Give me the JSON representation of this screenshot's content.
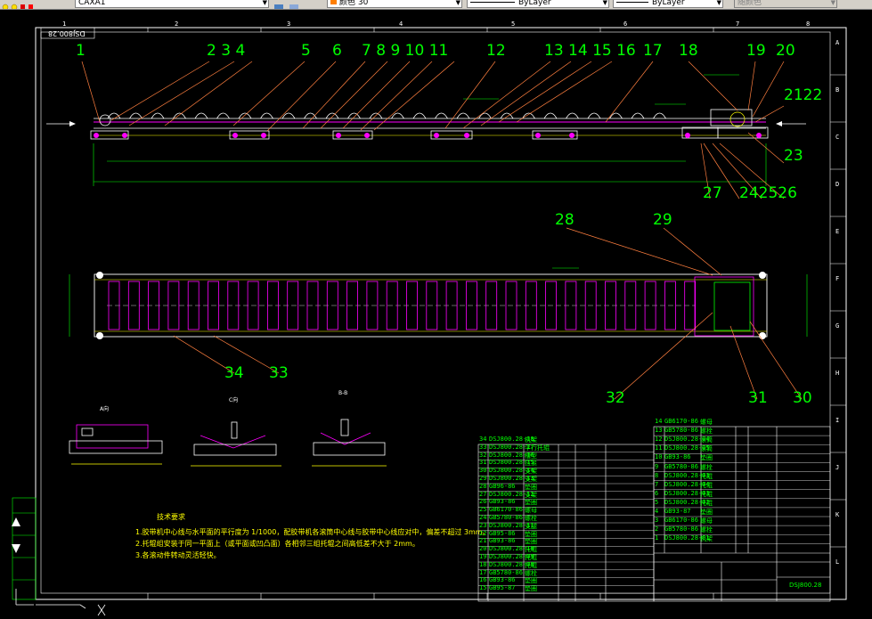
{
  "toolbar": {
    "layer_value": "CAXA1",
    "color_label": "颜色 30",
    "linetype_value": "ByLayer",
    "lineweight_value": "ByLayer",
    "plot_style": "随颜色"
  },
  "drawing": {
    "drawing_number_top": "DSJ800.28",
    "drawing_number_bottom": "DSJ800.28",
    "columns": [
      "1",
      "2",
      "3",
      "4",
      "5",
      "6",
      "7",
      "8"
    ],
    "rows": [
      "A",
      "B",
      "C",
      "D",
      "E",
      "F",
      "G",
      "H",
      "I",
      "J",
      "K",
      "L"
    ],
    "section_labels": [
      "A向",
      "C向",
      "B-B"
    ],
    "title_block_name": "DSJ800.28"
  },
  "callouts": [
    {
      "num": "1"
    },
    {
      "num": "2 3 4"
    },
    {
      "num": "5"
    },
    {
      "num": "6"
    },
    {
      "num": "7 8 9 10 11"
    },
    {
      "num": "12"
    },
    {
      "num": "13 14 15 16"
    },
    {
      "num": "17"
    },
    {
      "num": "18"
    },
    {
      "num": "19"
    },
    {
      "num": "20"
    },
    {
      "num": "2122"
    },
    {
      "num": "23"
    },
    {
      "num": "27"
    },
    {
      "num": "242526"
    },
    {
      "num": "28"
    },
    {
      "num": "29"
    },
    {
      "num": "34"
    },
    {
      "num": "33"
    },
    {
      "num": "32"
    },
    {
      "num": "31"
    },
    {
      "num": "30"
    }
  ],
  "notes": {
    "title": "技术要求",
    "lines": [
      "1.胶带机中心线与水平面的平行度为 1/1000，配胶带机各滚筒中心线与胶带中心线应对中，偏差不超过 3mm。",
      "2.托辊组安装于同一平面上（或平面或凹凸面）各相邻三组托辊之间高低差不大于 2mm。",
      "3.各滚动件转动灵活轻快。"
    ]
  },
  "parts_left": [
    {
      "no": "34",
      "code": "DSJ800.28-18",
      "name": "机架"
    },
    {
      "no": "33",
      "code": "DSJ800.28-17",
      "name": "平行托辊"
    },
    {
      "no": "32",
      "code": "DSJ800.28-16",
      "name": "槽型"
    },
    {
      "no": "31",
      "code": "DSJ800.28-15",
      "name": "拉紧"
    },
    {
      "no": "30",
      "code": "DSJ800.28-14",
      "name": "支架"
    },
    {
      "no": "29",
      "code": "DSJ800.28-13",
      "name": "支架"
    },
    {
      "no": "28",
      "code": "GB96-86",
      "name": "垫圈"
    },
    {
      "no": "27",
      "code": "DSJ800.28-12",
      "name": "支架"
    },
    {
      "no": "26",
      "code": "GB93-86",
      "name": "垫圈"
    },
    {
      "no": "25",
      "code": "GB6170-86",
      "name": "螺母"
    },
    {
      "no": "24",
      "code": "GB5780-86",
      "name": "螺栓"
    },
    {
      "no": "23",
      "code": "DSJ800.28-11",
      "name": "支腿"
    },
    {
      "no": "22",
      "code": "GB95-86",
      "name": "垫圈"
    },
    {
      "no": "21",
      "code": "GB93-86",
      "name": "垫圈"
    },
    {
      "no": "20",
      "code": "DSJ800.28-10",
      "name": "托辊"
    },
    {
      "no": "19",
      "code": "DSJ800.28-09",
      "name": "托辊"
    },
    {
      "no": "18",
      "code": "DSJ800.28-08",
      "name": "托辊"
    },
    {
      "no": "17",
      "code": "GB5780-86",
      "name": "螺栓"
    },
    {
      "no": "16",
      "code": "GB93-86",
      "name": "垫圈"
    },
    {
      "no": "15",
      "code": "GB95-87",
      "name": "垫圈"
    }
  ],
  "parts_right": [
    {
      "no": "14",
      "code": "GB6170-86",
      "name": "螺母"
    },
    {
      "no": "13",
      "code": "GB5780-86",
      "name": "螺栓"
    },
    {
      "no": "12",
      "code": "DSJ800.28-04",
      "name": "滚筒"
    },
    {
      "no": "11",
      "code": "DSJ800.28-05",
      "name": "滚筒"
    },
    {
      "no": "10",
      "code": "GB93-86",
      "name": "垫圈"
    },
    {
      "no": "9",
      "code": "GB5780-86",
      "name": "螺栓"
    },
    {
      "no": "8",
      "code": "DSJ800.28-03",
      "name": "托辊"
    },
    {
      "no": "7",
      "code": "DSJ800.28-04",
      "name": "托辊"
    },
    {
      "no": "6",
      "code": "DSJ800.28-03",
      "name": "托辊"
    },
    {
      "no": "5",
      "code": "DSJ800.28-02",
      "name": "托辊"
    },
    {
      "no": "4",
      "code": "GB93-87",
      "name": "垫圈"
    },
    {
      "no": "3",
      "code": "GB6170-86",
      "name": "螺母"
    },
    {
      "no": "2",
      "code": "GB5780-86",
      "name": "螺栓"
    },
    {
      "no": "1",
      "code": "DSJ800.28-01",
      "name": "机架"
    }
  ]
}
